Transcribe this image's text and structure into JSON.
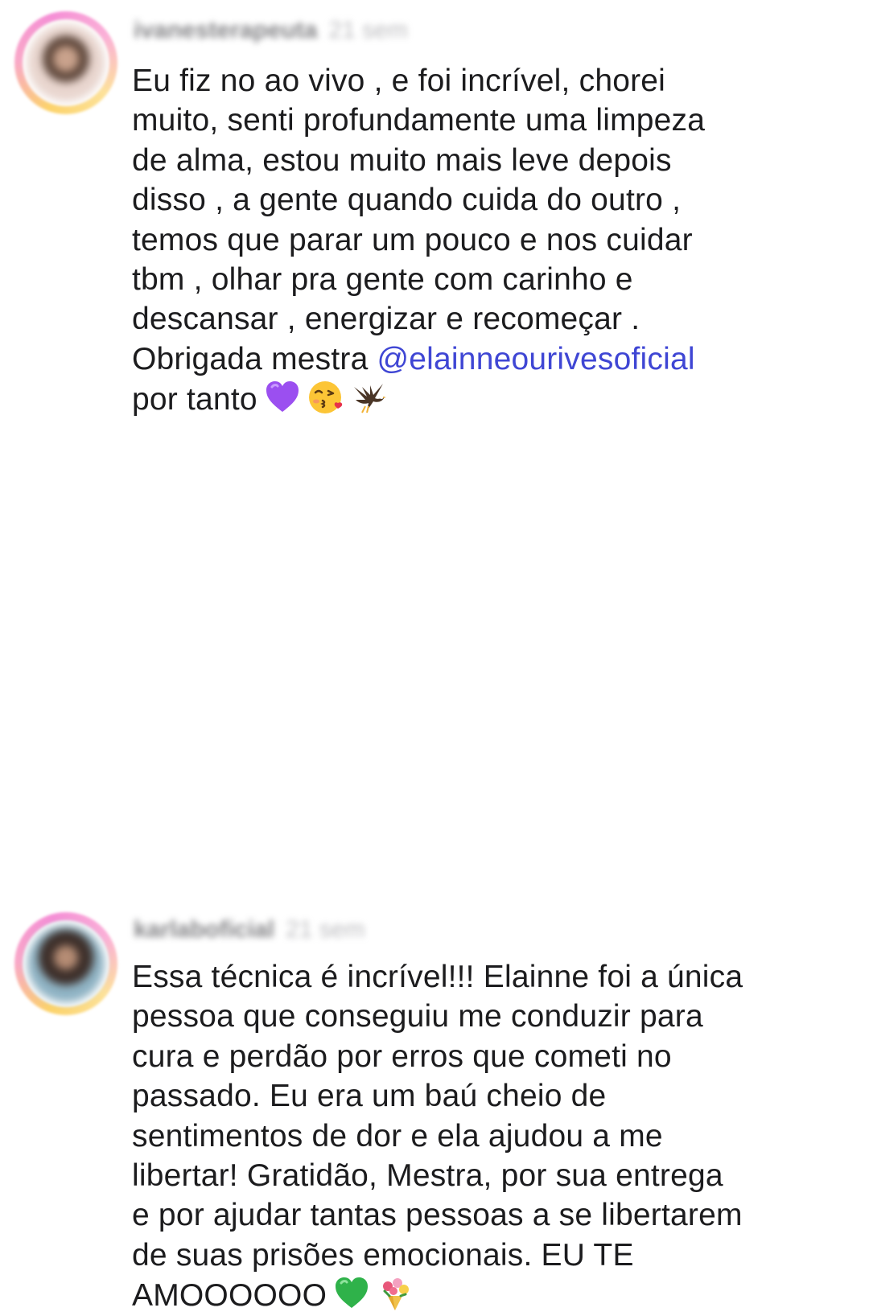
{
  "comments": [
    {
      "username": "ivanesterapeuta",
      "time": "21 sem",
      "lines": [
        "Eu fiz no ao vivo , e foi incrível, chorei",
        "muito, senti profundamente uma limpeza",
        "de alma, estou muito mais leve depois",
        "disso , a gente quando cuida do outro ,",
        "temos que parar um pouco e nos cuidar",
        "tbm , olhar pra gente com carinho e",
        "descansar , energizar e recomeçar ."
      ],
      "line8_prefix": "Obrigada mestra ",
      "mention": "@elainneourivesoficial",
      "last_line": "por tanto",
      "emojis": [
        "purple-heart-icon",
        "kissing-face-icon",
        "eagle-icon"
      ]
    },
    {
      "username": "karlaboficial",
      "time": "21 sem",
      "lines": [
        "Essa técnica é incrível!!! Elainne foi a única",
        "pessoa que conseguiu me conduzir para",
        "cura e perdão por erros que cometi no",
        "passado. Eu era um baú cheio de",
        "sentimentos de dor e ela ajudou a me",
        "libertar! Gratidão, Mestra, por sua entrega",
        "e por ajudar tantas pessoas a se libertarem",
        "de suas prisões emocionais. EU TE"
      ],
      "last_line": "AMOOOOOO",
      "emojis": [
        "green-heart-icon",
        "bouquet-icon"
      ]
    }
  ],
  "colors": {
    "text": "#1c1c1e",
    "mention": "#3f46d4",
    "background": "#ffffff"
  }
}
